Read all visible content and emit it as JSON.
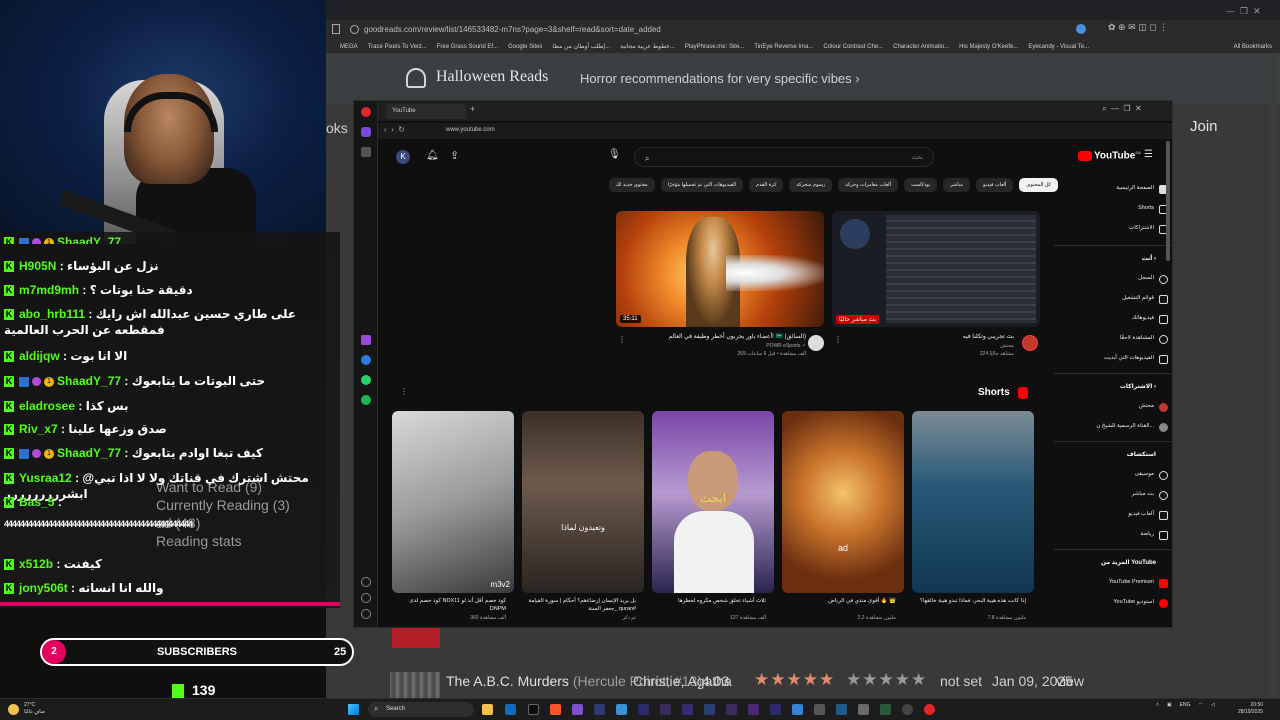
{
  "back_browser": {
    "url": "goodreads.com/review/list/146533482-m7ns?page=3&shelf=read&sort=date_added",
    "bookmarks": [
      "MEGA",
      "Trace Pixels To Vect...",
      "Free Grass Sound Ef...",
      "Google Sites",
      "إطلب أوطان من مطا...",
      "خطوط عربية مجانية...",
      "PlayPhrase.me: Site...",
      "TinEye Reverse Ima...",
      "Colour Contrast Che...",
      "Character Animatio...",
      "His Majesty O'Keefe...",
      "Eyecandy - Visual Te..."
    ],
    "all_bookmarks": "All Bookmarks",
    "banner_title": "Halloween Reads",
    "banner_subtitle": "Horror recommendations for very specific vibes",
    "join": "Join",
    "books_tab": "oks",
    "shelves": [
      "Want to Read (9)",
      "Currently Reading (3)",
      "ad (48)",
      "Reading stats"
    ],
    "book_row": {
      "title": "The A.B.C. Murders",
      "series": "(Hercule Poirot, #13)",
      "author": "Christie, Agatha",
      "rating": "4.03",
      "stars_avg": "★★★★★",
      "stars_user": "★★★★★",
      "date_read": "not set",
      "date_added": "Jan 09, 2025",
      "view": "view"
    }
  },
  "youtube": {
    "tab_title": "YouTube",
    "url": "www.youtube.com",
    "avatar_letter": "K",
    "search_placeholder": "بحث",
    "logo": "YouTube",
    "logo_region": "SA",
    "chips": [
      "محتوى جديد لك",
      "الفيديوهات التي تم تحميلها مؤخرًا",
      "كرة القدم",
      "رسوم متحركة",
      "ألعاب مغامرات وحركة",
      "بودكاست",
      "مباشر",
      "ألعاب فيديو",
      "كل المحتوى"
    ],
    "videos": [
      {
        "duration": "35:11",
        "title": "أعضاء باور يجربون أخطر وظيفة في العالم! 🇸🇦 (السائق)",
        "channel": "POWR eSports ✓",
        "meta": "269 ألف مشاهدة • قبل 6 ساعات"
      },
      {
        "duration": "بث مباشر حاليًا",
        "title": "بث تجريبي وتكلنا فيه",
        "channel": "محتش",
        "meta": "224 مشاهد حاليًا"
      }
    ],
    "shorts_heading": "Shorts",
    "shorts": [
      {
        "title": "كود خصم لدى NDX11 كود خصم أقل أند لو DNPM",
        "meta": "360 ألف مشاهدة"
      },
      {
        "title": "يل يريد الإنسان إرضاءهم؟ أحكام | سورة القيامة جعفر السنة_ quran#",
        "meta": "تم ذكر"
      },
      {
        "title": "ثلاث أشياء تخلق شخص مكروه لحظرها",
        "meta": "127 ألف مشاهدة"
      },
      {
        "title": "أقوى مندي في الرياض 🔥 👑",
        "meta": "2.2 مليون مشاهدة"
      },
      {
        "title": "إذا كانت هذه هيبة البحر، فماذا تبدو هيبة خالقها؟",
        "meta": "7.8 مليون مشاهدة"
      }
    ],
    "short_overlays": [
      "m3v2",
      "وتعبدون لماذا",
      "ابحث",
      "ad",
      ""
    ],
    "guide": {
      "main": [
        "الصفحة الرئيسية",
        "Shorts",
        "الاشتراكات"
      ],
      "you_heading": "أنت",
      "you": [
        "السجل",
        "قوائم التشغيل",
        "فيديوهاتك",
        "المشاهدة لاحقًا",
        "الفيديوهات التي أبديت"
      ],
      "subs_heading": "الاشتراكات",
      "subs": [
        "محتش",
        "القناة الرسمية للشيخ ن..."
      ],
      "explore_heading": "استكشاف",
      "explore": [
        "موسيقى",
        "بث مباشر",
        "ألعاب فيديو",
        "رياضة"
      ],
      "more_heading": "المزيد من YouTube",
      "more": [
        "YouTube Premium",
        "YouTube استوديو"
      ]
    }
  },
  "chat": {
    "lines": [
      {
        "user": "ShaadY_77",
        "msg": "",
        "badges": [
          "blue",
          "purple",
          "gold"
        ]
      },
      {
        "user": "H905N",
        "msg": ": نزل عن البؤساء",
        "badges": []
      },
      {
        "user": "m7md9mh",
        "msg": ": دقيقة حنا بوتات ؟",
        "badges": []
      },
      {
        "user": "abo_hrb111",
        "msg": ": على طاري حسين عبدالله اش رايك فمقطعه عن الحرب العالمية",
        "badges": []
      },
      {
        "user": "aldijqw",
        "msg": ": الا انا بوت",
        "badges": []
      },
      {
        "user": "ShaadY_77",
        "msg": ": حتى البوتات ما يتابعوك",
        "badges": [
          "blue",
          "purple",
          "gold"
        ]
      },
      {
        "user": "eladrosee",
        "msg": ": بس كذا",
        "badges": []
      },
      {
        "user": "Riv_x7",
        "msg": ": صدق وزعها علينا",
        "badges": []
      },
      {
        "user": "ShaadY_77",
        "msg": ": كيف تبغا اوادم يتابعوك",
        "badges": [
          "blue",
          "purple",
          "gold"
        ]
      },
      {
        "user": "Yusraa12",
        "msg": ": @محتش اشترك في قناتك ولا لا اذا تبي ابشررررررررر",
        "badges": []
      },
      {
        "user": "Bas_5",
        "msg": ":",
        "badges": []
      },
      {
        "user": "",
        "msg": "44444444444444444444444444444444444444444444444",
        "badges": []
      },
      {
        "user": "x512b",
        "msg": ": كيفنت",
        "badges": []
      },
      {
        "user": "jony506t",
        "msg": ": والله انا انساته",
        "badges": []
      }
    ],
    "gold_badge_text": "1"
  },
  "subscriber_goal": {
    "current": "2",
    "label": "SUBSCRIBERS",
    "goal": "25"
  },
  "followers": "139",
  "taskbar": {
    "weather_temp": "27°C",
    "weather_desc": "صافٍ غالبًا",
    "search_placeholder": "Search",
    "lang": "ENG",
    "time": "20:50",
    "date": "28/10/2025"
  },
  "colors": {
    "kick_green": "#53fc18",
    "accent_pink": "#e5005f",
    "youtube_red": "#ff0000",
    "goodreads_star": "#e08d6f"
  }
}
